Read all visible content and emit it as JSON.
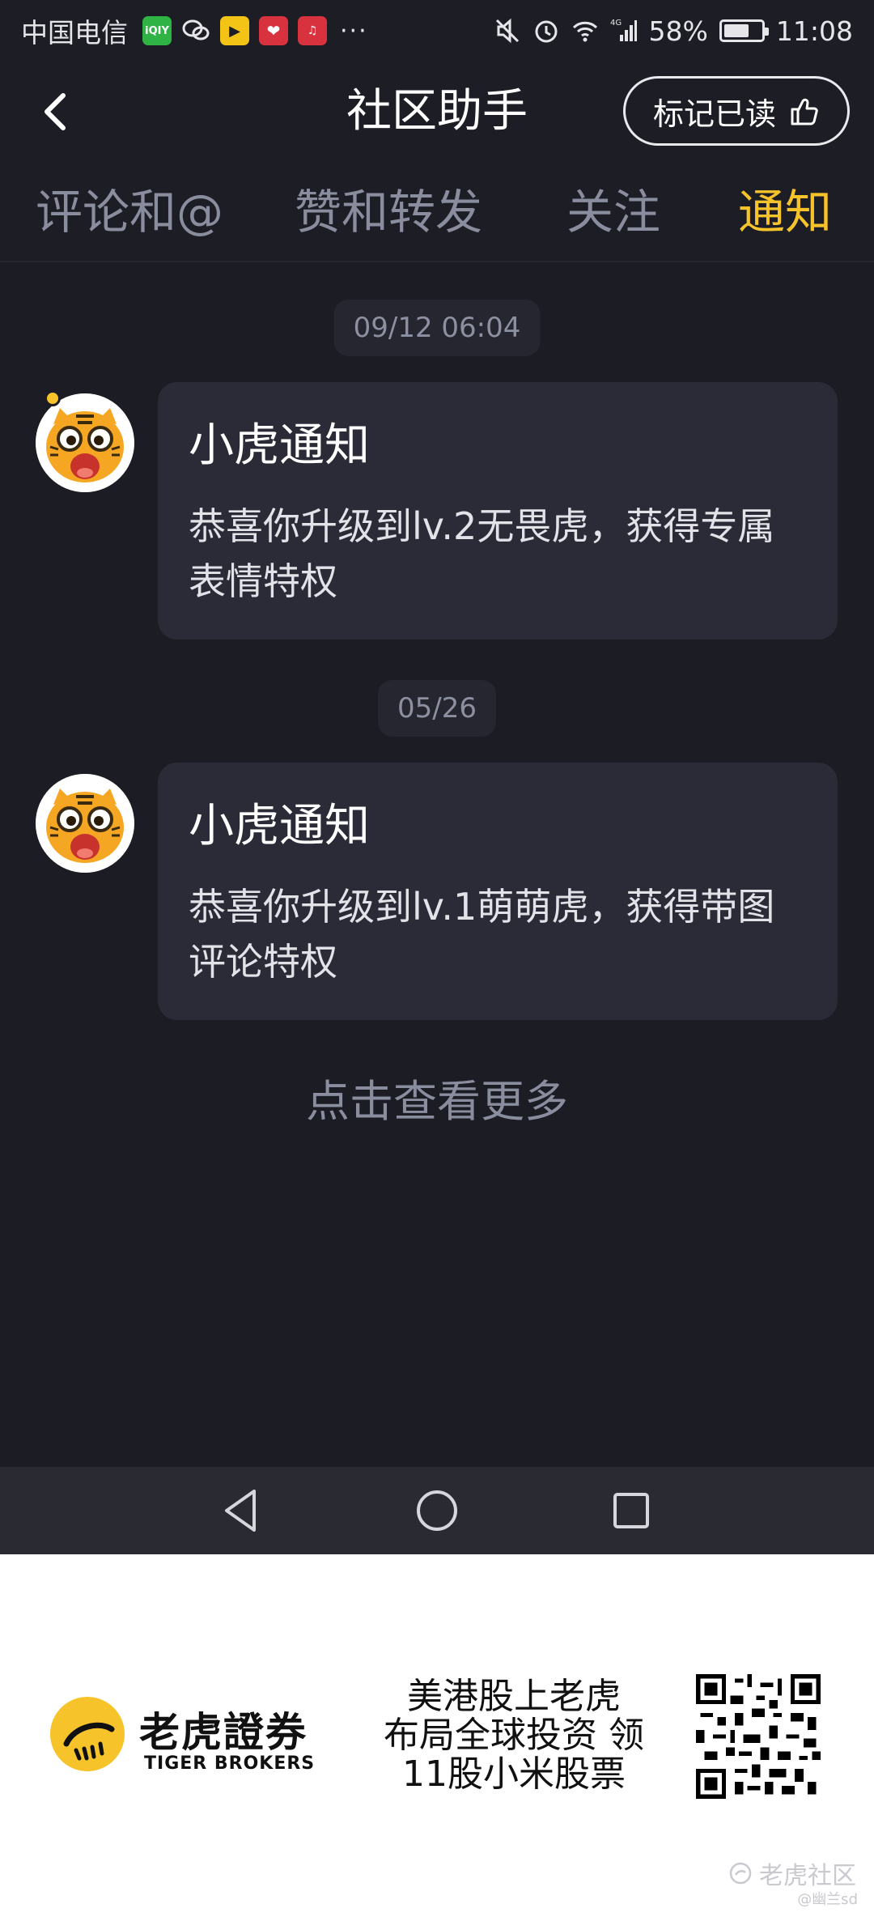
{
  "status_bar": {
    "carrier": "中国电信",
    "apps": [
      "iqiyi-icon",
      "wechat-icon",
      "video-icon",
      "heart-icon",
      "music-icon"
    ],
    "more": "···",
    "battery": "58%",
    "time": "11:08",
    "network": "4G"
  },
  "header": {
    "title": "社区助手",
    "mark_read_label": "标记已读"
  },
  "tabs": [
    {
      "label": "评论和@",
      "active": false
    },
    {
      "label": "赞和转发",
      "active": false
    },
    {
      "label": "关注",
      "active": false
    },
    {
      "label": "通知",
      "active": true
    }
  ],
  "notifications": [
    {
      "time": "09/12 06:04",
      "unread": true,
      "title": "小虎通知",
      "text": "恭喜你升级到lv.2无畏虎，获得专属表情特权"
    },
    {
      "time": "05/26",
      "unread": false,
      "title": "小虎通知",
      "text": "恭喜你升级到lv.1萌萌虎，获得带图评论特权"
    }
  ],
  "load_more": "点击查看更多",
  "ad": {
    "brand_cn": "老虎證券",
    "brand_en": "TIGER BROKERS",
    "slogan_line1": "美港股上老虎",
    "slogan_line2": "布局全球投资 领",
    "slogan_line3": "11股小米股票",
    "watermark": "老虎社区",
    "watermark_sub": "@幽兰sd"
  },
  "colors": {
    "background": "#1c1c24",
    "accent": "#f6c32b",
    "bubble": "#2b2b37",
    "muted_text": "#8a8d9e"
  }
}
